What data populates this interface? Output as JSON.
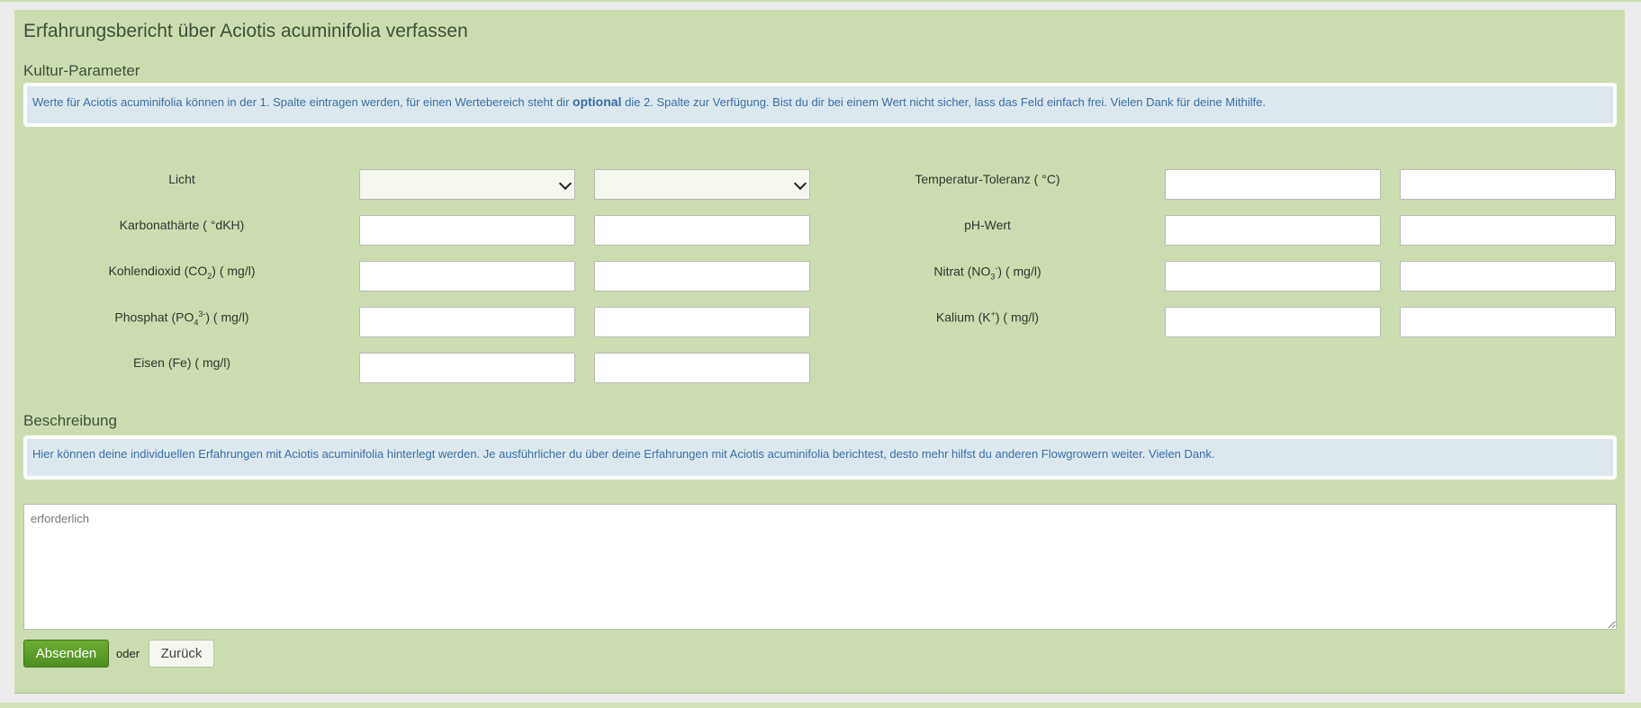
{
  "page": {
    "title": "Erfahrungsbericht über Aciotis acuminifolia verfassen"
  },
  "kultur": {
    "heading": "Kultur-Parameter",
    "info_pre": "Werte für Aciotis acuminifolia können in der 1. Spalte eintragen werden, für einen Wertebereich steht dir",
    "info_bold": "optional",
    "info_post": "die 2. Spalte zur Verfügung. Bist du dir bei einem Wert nicht sicher, lass das Feld einfach frei. Vielen Dank für deine Mithilfe."
  },
  "params": {
    "licht": "Licht",
    "temperatur": "Temperatur-Toleranz ( °C)",
    "karbonat": "Karbonathärte ( °dKH)",
    "ph": "pH-Wert",
    "co2_pre": "Kohlendioxid (CO",
    "co2_sub": "2",
    "co2_post": ") ( mg/l)",
    "nitrat_pre": "Nitrat (NO",
    "nitrat_sub": "3",
    "nitrat_sup": "-",
    "nitrat_post": ") ( mg/l)",
    "phosphat_pre": "Phosphat (PO",
    "phosphat_sub": "4",
    "phosphat_sup": "3-",
    "phosphat_post": ") ( mg/l)",
    "kalium_pre": "Kalium (K",
    "kalium_sup": "+",
    "kalium_post": ") ( mg/l)",
    "eisen": "Eisen (Fe) ( mg/l)"
  },
  "beschreibung": {
    "heading": "Beschreibung",
    "info": "Hier können deine individuellen Erfahrungen mit Aciotis acuminifolia hinterlegt werden. Je ausführlicher du über deine Erfahrungen mit Aciotis acuminifolia berichtest, desto mehr hilfst du anderen Flowgrowern weiter. Vielen Dank.",
    "placeholder": "erforderlich"
  },
  "actions": {
    "submit": "Absenden",
    "or": "oder",
    "back": "Zurück"
  },
  "colors": {
    "panel": "#cbddb0",
    "info_bg": "#dde8ee",
    "info_text": "#3a6ea5",
    "primary": "#5a9b29"
  }
}
